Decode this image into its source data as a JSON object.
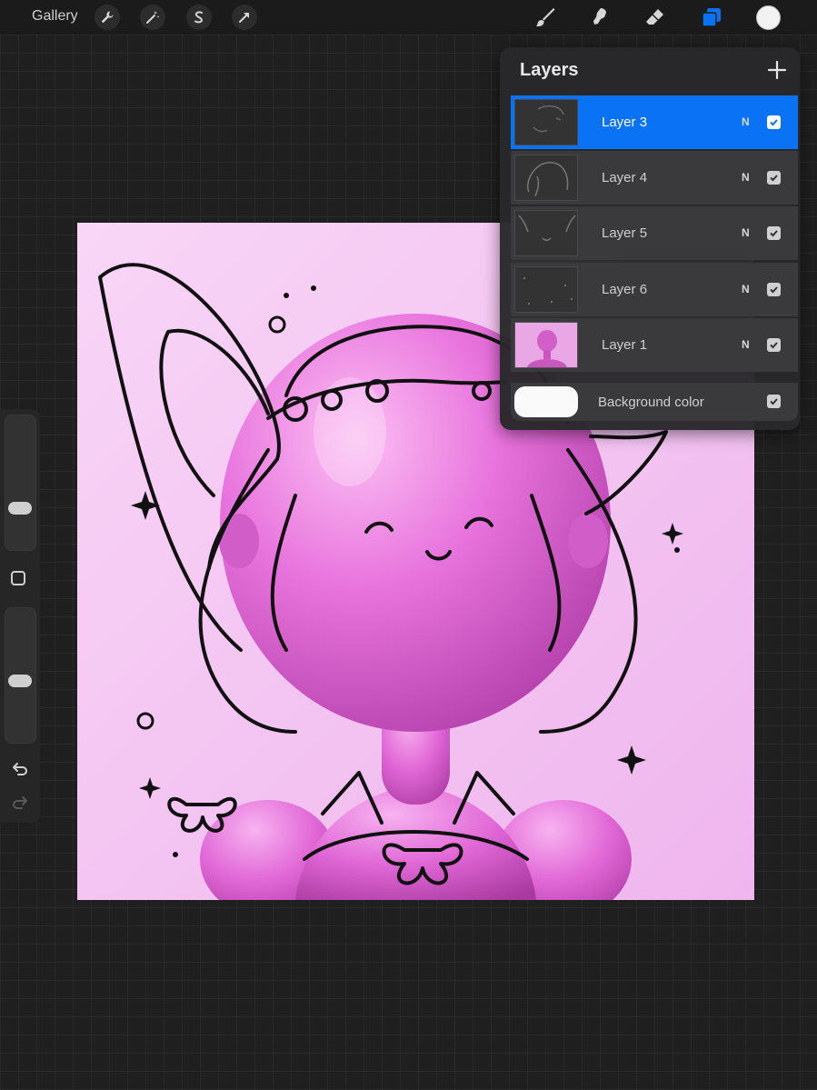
{
  "toolbar": {
    "gallery_label": "Gallery",
    "left_actions": [
      {
        "name": "actions-wrench-icon"
      },
      {
        "name": "adjustments-wand-icon"
      },
      {
        "name": "selection-icon"
      },
      {
        "name": "transform-arrow-icon"
      }
    ],
    "tools": [
      {
        "name": "brush-icon",
        "active": false
      },
      {
        "name": "smudge-icon",
        "active": false
      },
      {
        "name": "eraser-icon",
        "active": false
      },
      {
        "name": "layers-icon",
        "active": true
      }
    ],
    "current_color": "#f2f2f2",
    "accent_color": "#0a72f5"
  },
  "sidebar": {
    "brush_size_level": 0.28,
    "opacity_level": 0.45,
    "modify_label": "",
    "undo_icon": "undo-icon",
    "redo_icon": "redo-icon"
  },
  "layers_panel": {
    "title": "Layers",
    "add_icon": "plus-icon",
    "layers": [
      {
        "name": "Layer 3",
        "blend": "N",
        "visible": true,
        "selected": true
      },
      {
        "name": "Layer 4",
        "blend": "N",
        "visible": true,
        "selected": false
      },
      {
        "name": "Layer 5",
        "blend": "N",
        "visible": true,
        "selected": false
      },
      {
        "name": "Layer 6",
        "blend": "N",
        "visible": true,
        "selected": false
      },
      {
        "name": "Layer 1",
        "blend": "N",
        "visible": true,
        "selected": false
      }
    ],
    "background": {
      "name": "Background color",
      "visible": true,
      "color": "#fafafa"
    }
  },
  "canvas": {
    "background_color": "#f5c8f3",
    "figure_color": "#e56fd9"
  }
}
